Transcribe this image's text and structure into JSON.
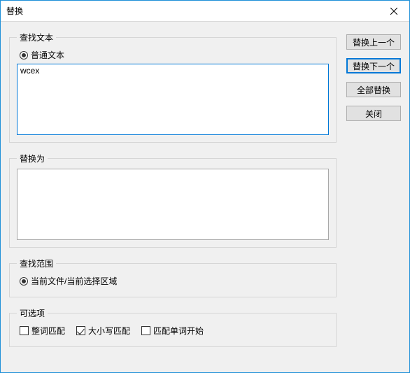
{
  "window": {
    "title": "替换"
  },
  "groups": {
    "find": {
      "legend": "查找文本",
      "radio_plain_label": "普通文本",
      "value": "wcex"
    },
    "replace": {
      "legend": "替换为",
      "value": ""
    },
    "scope": {
      "legend": "查找范围",
      "radio_current_label": "当前文件/当前选择区域"
    },
    "options": {
      "legend": "可选项",
      "whole_word_label": "整词匹配",
      "case_label": "大小写匹配",
      "word_start_label": "匹配单词开始"
    }
  },
  "buttons": {
    "replace_prev": "替换上一个",
    "replace_next": "替换下一个",
    "replace_all": "全部替换",
    "close": "关闭"
  }
}
